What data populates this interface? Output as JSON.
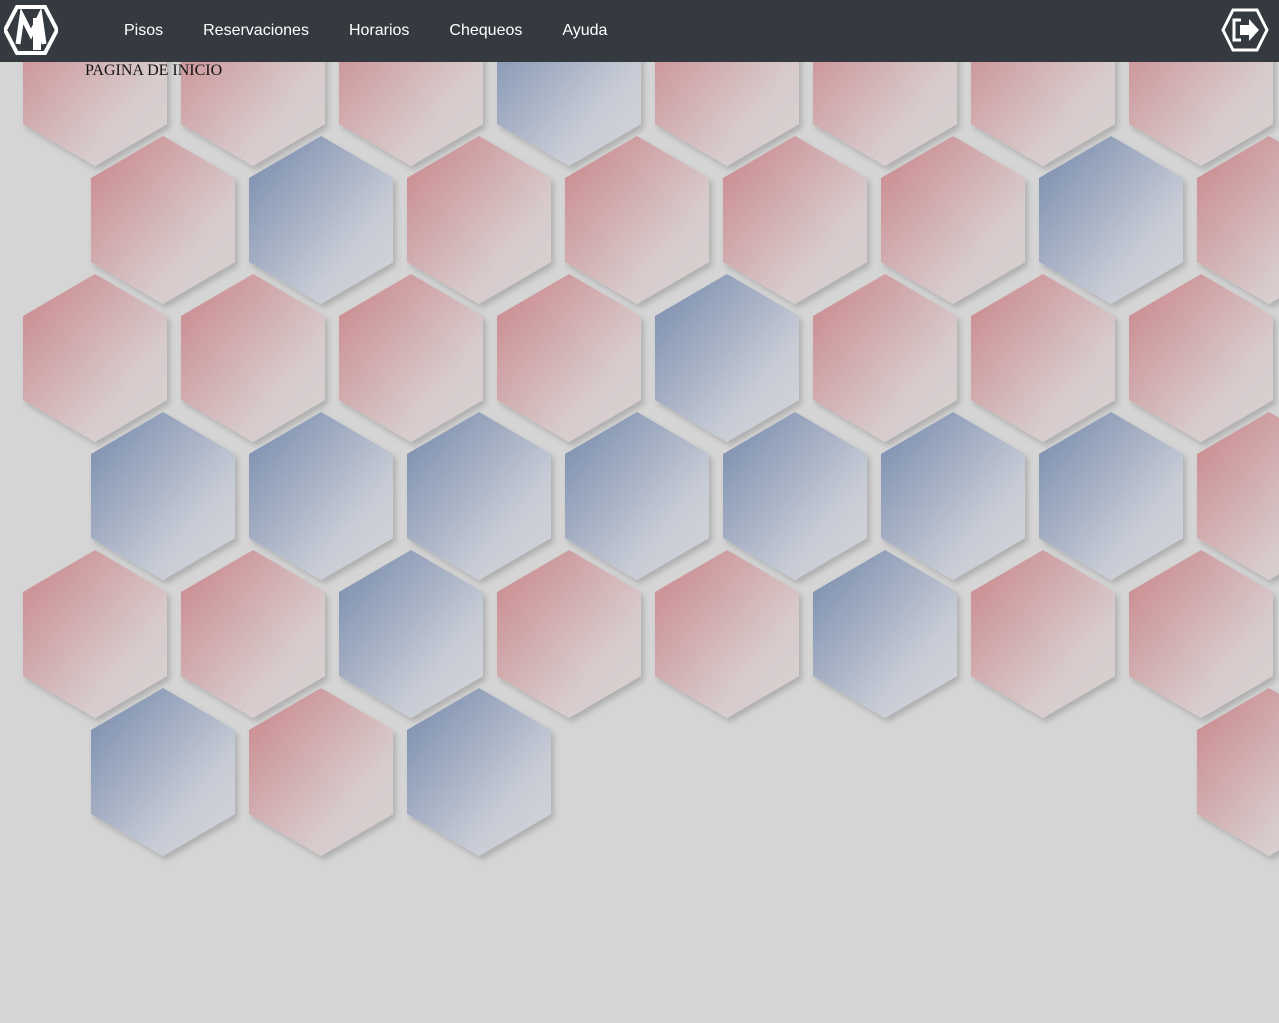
{
  "navbar": {
    "logo_icon": "brand-logo-icon",
    "links": [
      {
        "label": "Pisos"
      },
      {
        "label": "Reservaciones"
      },
      {
        "label": "Horarios"
      },
      {
        "label": "Chequeos"
      },
      {
        "label": "Ayuda"
      }
    ],
    "logout_icon": "logout-icon",
    "background": "#343a40"
  },
  "page": {
    "title": "PAGINA DE INICIO",
    "background": "#d5d5d5"
  },
  "hex_pattern": {
    "colors": {
      "red": "#cc8a8e",
      "blue": "#7d90b0",
      "fade": "#d9d3d3"
    },
    "rows": [
      "rrrbrrrr",
      "rbrrrrbrr",
      "rrrrbrrrr",
      "bbbbbbbrb",
      "rrbrrbrr",
      "brb....rrb"
    ]
  }
}
